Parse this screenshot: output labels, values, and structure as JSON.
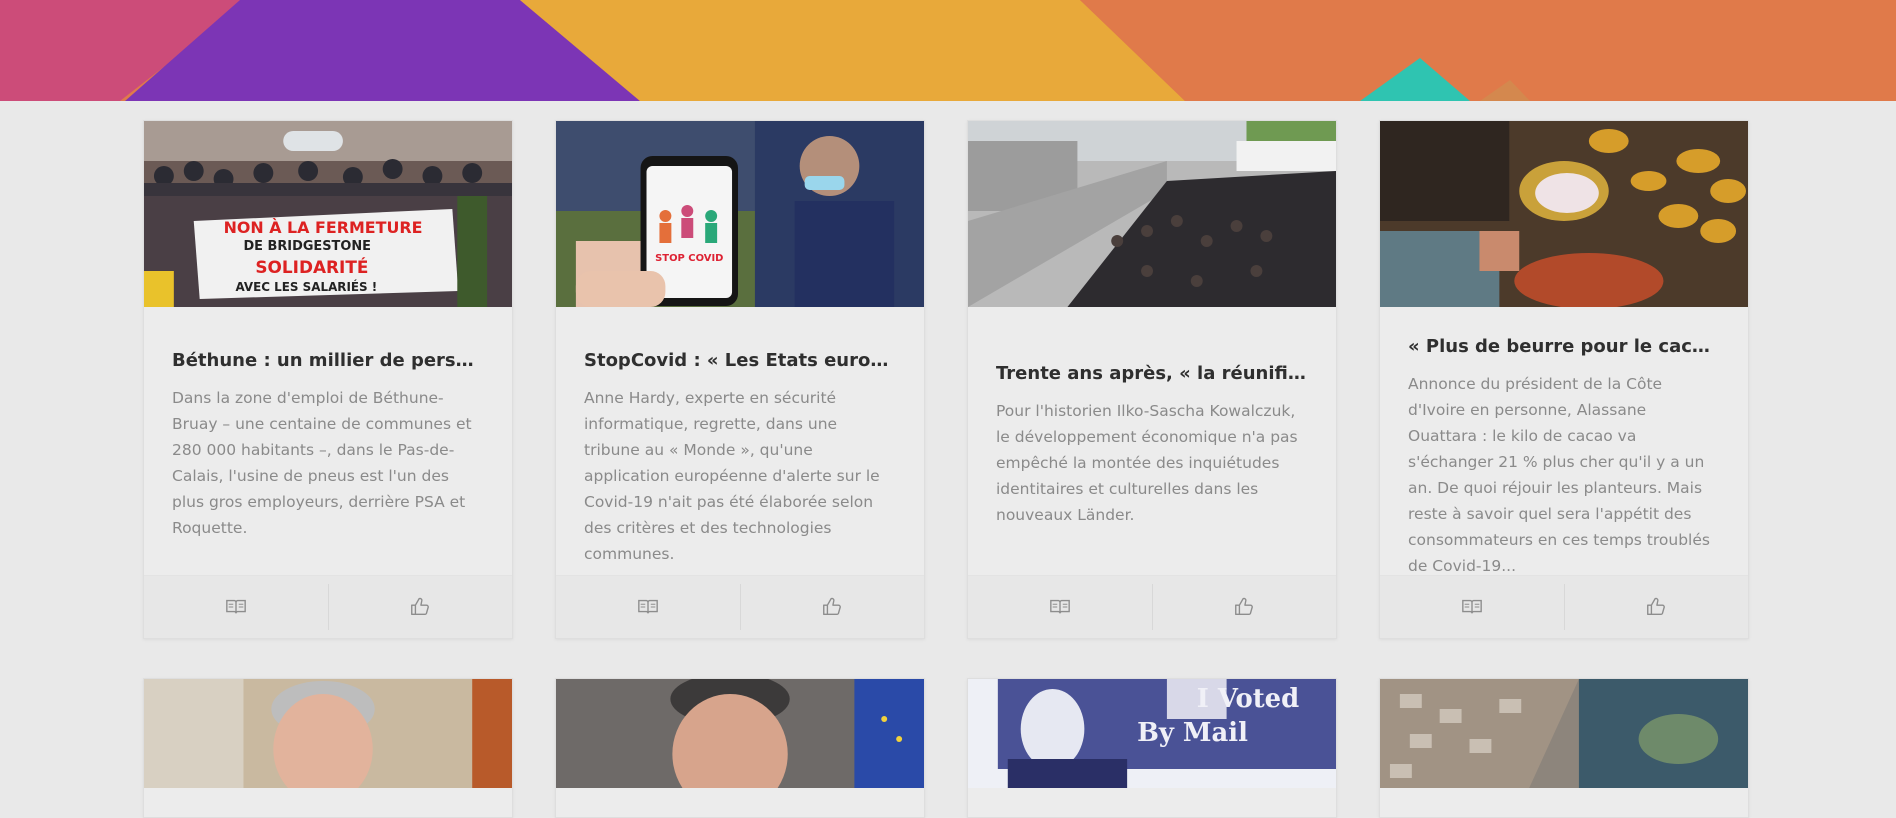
{
  "banner": {
    "colors": {
      "pink": "#cc4c79",
      "purple": "#7c35b5",
      "yellow": "#e8a93a",
      "orange": "#e07a4a",
      "teal": "#2fc4b1"
    }
  },
  "cards": [
    {
      "title": "Béthune : un millier de personne...",
      "description": "Dans la zone d'emploi de Béthune-Bruay – une centaine de communes et 280 000 habitants –, dans le Pas-de-Calais, l'usine de pneus est l'un des plus gros employeurs, derrière PSA et Roquette.",
      "banner_line1": "NON À LA FERMETURE",
      "banner_line2": "DE BRIDGESTONE",
      "banner_line3": "SOLIDARITÉ",
      "banner_line4": "AVEC LES SALARIÉS !",
      "read_icon": "book-icon",
      "like_icon": "thumbs-up-icon"
    },
    {
      "title": "StopCovid : « Les Etats européen...",
      "description": "Anne Hardy, experte en sécurité informatique, regrette, dans une tribune au « Monde », qu'une application européenne d'alerte sur le Covid-19 n'ait pas été élaborée selon des critères et des technologies communes.",
      "phone_text": "STOP COVID",
      "read_icon": "book-icon",
      "like_icon": "thumbs-up-icon"
    },
    {
      "title": "Trente ans après, « la réunificati...",
      "description": "Pour l'historien Ilko-Sascha Kowalczuk, le développement économique n'a pas empêché la montée des inquiétudes identitaires et culturelles dans les nouveaux Länder.",
      "read_icon": "book-icon",
      "like_icon": "thumbs-up-icon"
    },
    {
      "title": "« Plus de beurre pour le cacao »",
      "description": "Annonce du président de la Côte d'Ivoire en personne, Alassane Ouattara : le kilo de cacao va s'échanger 21 % plus cher qu'il y a un an. De quoi réjouir les planteurs. Mais reste à savoir quel sera l'appétit des consommateurs en ces temps troublés de Covid-19...",
      "read_icon": "book-icon",
      "like_icon": "thumbs-up-icon"
    }
  ],
  "bottom_cards": [
    {
      "image": "portrait-man-grey-hair"
    },
    {
      "image": "portrait-man-eu-flag"
    },
    {
      "image": "voted-by-mail",
      "image_text1": "I Voted",
      "image_text2": "By Mail"
    },
    {
      "image": "aerial-flood-map"
    }
  ]
}
